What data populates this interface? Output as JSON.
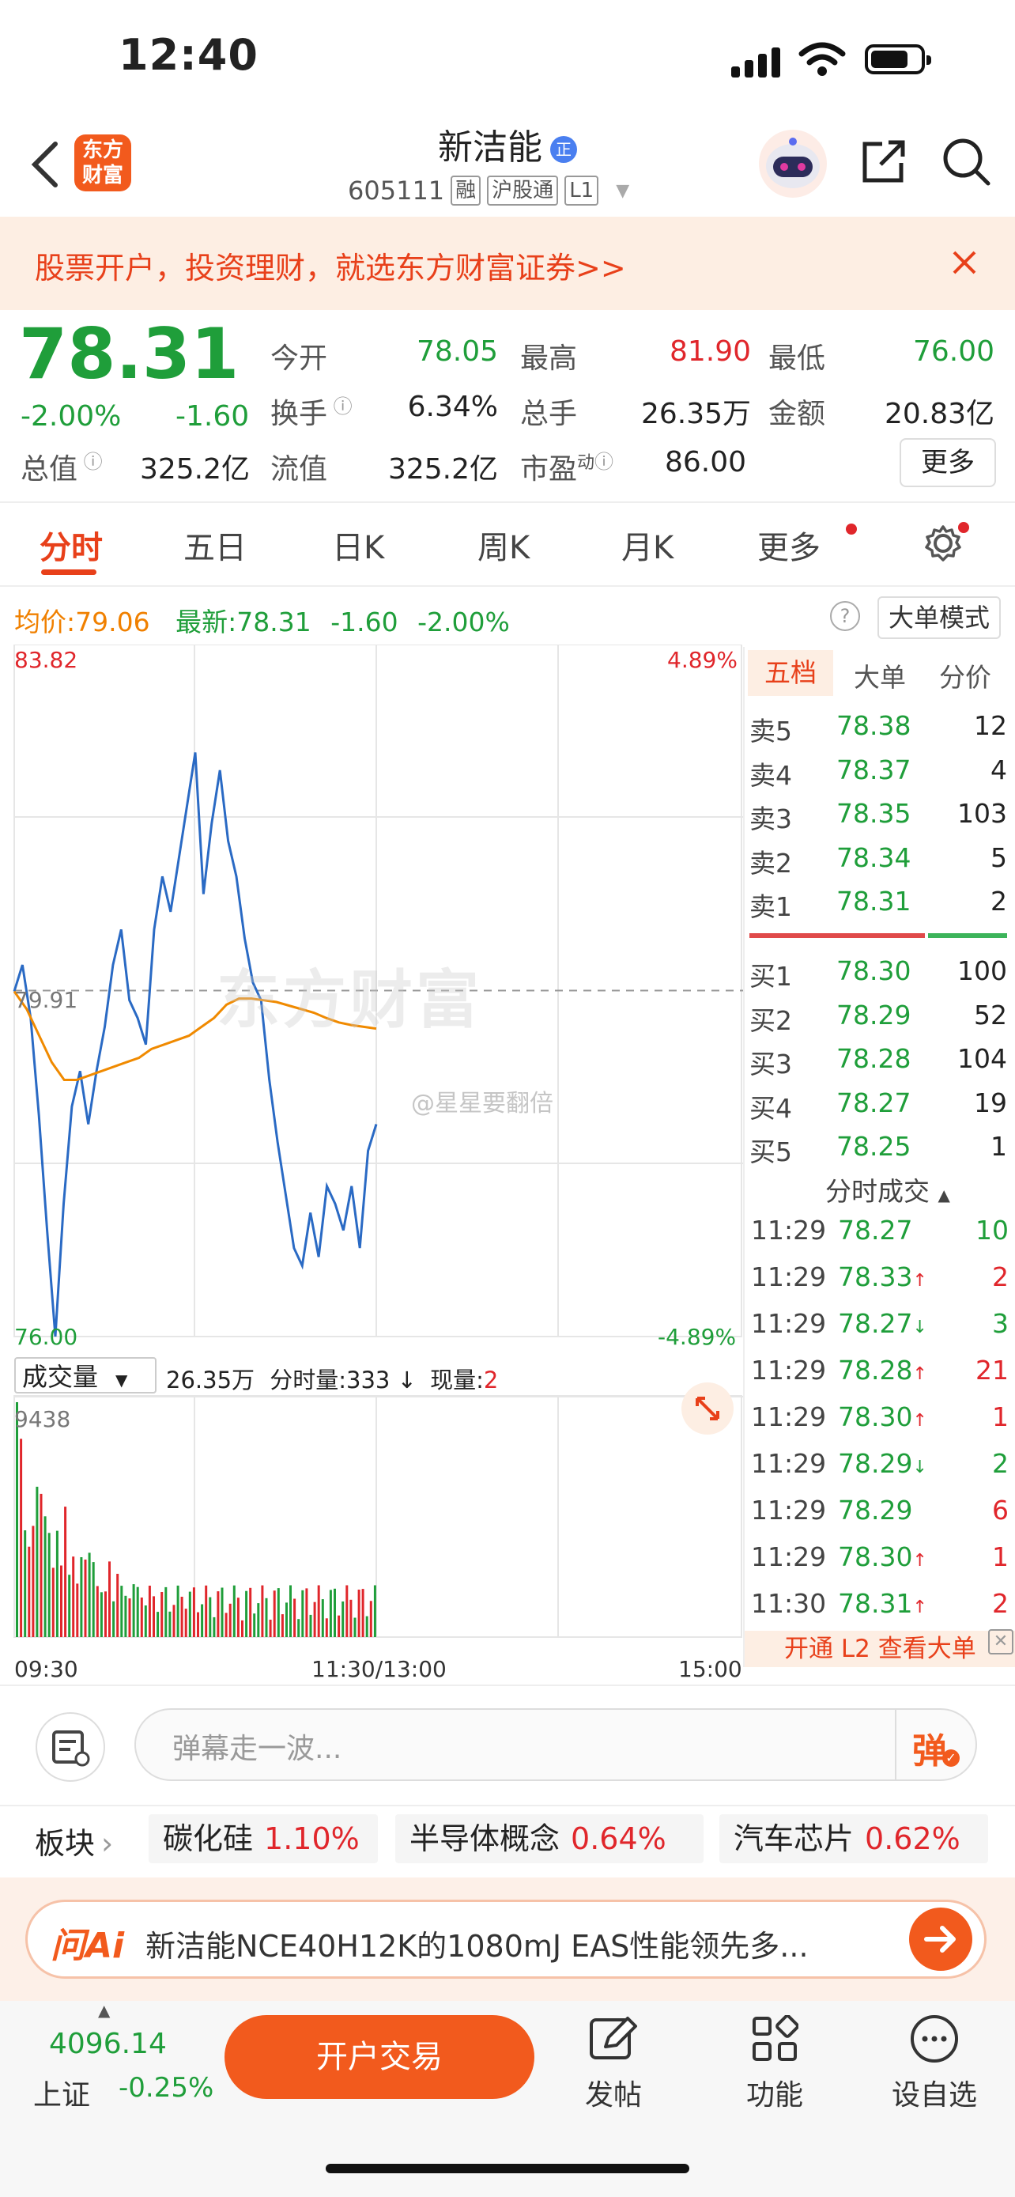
{
  "status": {
    "time": "12:40"
  },
  "header": {
    "logo_text": "东方\n财富",
    "name": "新洁能",
    "badge": "正",
    "code": "605111",
    "tags": [
      "融",
      "沪股通",
      "L1"
    ]
  },
  "promo": {
    "text": "股票开户，投资理财，就选东方财富证券>>"
  },
  "quote": {
    "price": "78.31",
    "change_pct": "-2.00%",
    "change": "-1.60",
    "open_label": "今开",
    "open": "78.05",
    "high_label": "最高",
    "high": "81.90",
    "low_label": "最低",
    "low": "76.00",
    "turnover_label": "换手",
    "turnover": "6.34%",
    "volume_label": "总手",
    "volume": "26.35万",
    "amount_label": "金额",
    "amount": "20.83亿",
    "mktcap_label": "总值",
    "mktcap": "325.2亿",
    "float_label": "流值",
    "float": "325.2亿",
    "pe_label": "市盈",
    "pe_sup": "动",
    "pe": "86.00",
    "more_button": "更多"
  },
  "tabs": [
    "分时",
    "五日",
    "日K",
    "周K",
    "月K",
    "更多"
  ],
  "active_tab": "分时",
  "chart_info": {
    "avg_label": "均价:",
    "avg": "79.06",
    "latest_label": "最新:",
    "latest": "78.31",
    "latest_change": "-1.60",
    "latest_pct": "-2.00%",
    "big_order_mode": "大单模式",
    "help_icon": "?"
  },
  "chart_data": {
    "type": "line",
    "y_top": "83.82",
    "y_top_pct": "4.89%",
    "y_mid": "79.91",
    "y_bottom": "76.00",
    "y_bottom_pct": "-4.89%",
    "ylim": [
      76.0,
      83.82
    ],
    "x_ticks": [
      "09:30",
      "11:30/13:00",
      "15:00"
    ],
    "watermark": "东方财富",
    "weibo_mark": "@星星要翻倍",
    "series": [
      {
        "values": [
          79.9,
          80.2,
          79.6,
          78.5,
          77.2,
          76.0,
          77.5,
          78.6,
          79.0,
          78.4,
          79.0,
          79.5,
          80.2,
          80.6,
          79.8,
          79.6,
          79.3,
          80.6,
          81.2,
          80.8,
          81.4,
          82.0,
          82.6,
          81.0,
          81.8,
          82.4,
          81.6,
          81.2,
          80.5,
          80.0,
          79.8,
          78.9,
          78.2,
          77.6,
          77.0,
          76.8,
          77.4,
          76.9,
          77.7,
          77.5,
          77.2,
          77.7,
          77.0,
          78.1,
          78.4
        ]
      },
      {
        "values": [
          79.9,
          79.7,
          79.4,
          79.1,
          78.9,
          78.9,
          78.95,
          79.0,
          79.05,
          79.1,
          79.15,
          79.25,
          79.3,
          79.35,
          79.4,
          79.5,
          79.6,
          79.75,
          79.82,
          79.82,
          79.8,
          79.78,
          79.74,
          79.7,
          79.66,
          79.6,
          79.55,
          79.52,
          79.5,
          79.48
        ]
      }
    ]
  },
  "volume": {
    "label": "成交量",
    "total": "26.35万",
    "min_label": "分时量:",
    "min_value": "333",
    "now_label": "现量:",
    "now_value": "2",
    "max": "9438"
  },
  "orderbook": {
    "tabs": [
      "五档",
      "大单",
      "分价"
    ],
    "asks": [
      {
        "label": "卖5",
        "price": "78.38",
        "qty": "12"
      },
      {
        "label": "卖4",
        "price": "78.37",
        "qty": "4"
      },
      {
        "label": "卖3",
        "price": "78.35",
        "qty": "103"
      },
      {
        "label": "卖2",
        "price": "78.34",
        "qty": "5"
      },
      {
        "label": "卖1",
        "price": "78.31",
        "qty": "2"
      }
    ],
    "bids": [
      {
        "label": "买1",
        "price": "78.30",
        "qty": "100"
      },
      {
        "label": "买2",
        "price": "78.29",
        "qty": "52"
      },
      {
        "label": "买3",
        "price": "78.28",
        "qty": "104"
      },
      {
        "label": "买4",
        "price": "78.27",
        "qty": "19"
      },
      {
        "label": "买5",
        "price": "78.25",
        "qty": "1"
      }
    ],
    "trades_title": "分时成交",
    "trades": [
      {
        "time": "11:29",
        "price": "78.27",
        "arrow": "",
        "qty": "10",
        "qty_color": "green"
      },
      {
        "time": "11:29",
        "price": "78.33",
        "arrow": "↑",
        "qty": "2",
        "qty_color": "red"
      },
      {
        "time": "11:29",
        "price": "78.27",
        "arrow": "↓",
        "qty": "3",
        "qty_color": "green"
      },
      {
        "time": "11:29",
        "price": "78.28",
        "arrow": "↑",
        "qty": "21",
        "qty_color": "red"
      },
      {
        "time": "11:29",
        "price": "78.30",
        "arrow": "↑",
        "qty": "1",
        "qty_color": "red"
      },
      {
        "time": "11:29",
        "price": "78.29",
        "arrow": "↓",
        "qty": "2",
        "qty_color": "green"
      },
      {
        "time": "11:29",
        "price": "78.29",
        "arrow": "",
        "qty": "6",
        "qty_color": "red"
      },
      {
        "time": "11:29",
        "price": "78.30",
        "arrow": "↑",
        "qty": "1",
        "qty_color": "red"
      },
      {
        "time": "11:30",
        "price": "78.31",
        "arrow": "↑",
        "qty": "2",
        "qty_color": "red"
      }
    ],
    "l2_prompt": "开通 L2 查看大单"
  },
  "comment": {
    "placeholder": "弹幕走一波...",
    "danmu_button": "弹"
  },
  "sectors": {
    "label": "板块",
    "items": [
      {
        "name": "碳化硅",
        "pct": "1.10%"
      },
      {
        "name": "半导体概念",
        "pct": "0.64%"
      },
      {
        "name": "汽车芯片",
        "pct": "0.62%"
      }
    ]
  },
  "ai": {
    "logo": "问Ai",
    "text": "新洁能NCE40H12K的1080mJ EAS性能领先多..."
  },
  "bottom_nav": {
    "index_value": "4096.14",
    "index_name": "上证",
    "index_pct": "-0.25%",
    "trade_button": "开户交易",
    "post": "发帖",
    "functions": "功能",
    "watchlist": "设自选"
  },
  "colors": {
    "up": "#e0262b",
    "down": "#1f9e3a",
    "brand": "#f25a1d",
    "avg_line": "#f08a00",
    "price_line": "#2a6ac4"
  }
}
